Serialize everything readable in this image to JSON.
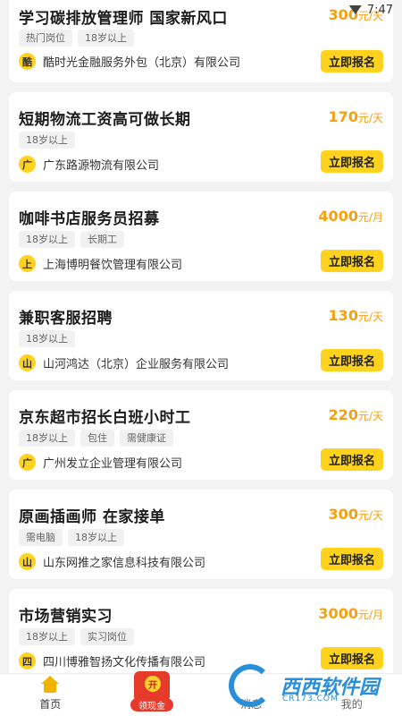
{
  "status": {
    "time": "7:47"
  },
  "jobs": [
    {
      "title": "学习碳排放管理师 国家新风口",
      "salary": "300",
      "unit": "元/天",
      "tags": [
        "热门岗位",
        "18岁以上"
      ],
      "badge": "酷",
      "company": "酷时光金融服务外包（北京）有限公司",
      "apply": "立即报名"
    },
    {
      "title": "短期物流工资高可做长期",
      "salary": "170",
      "unit": "元/天",
      "tags": [
        "18岁以上"
      ],
      "badge": "广",
      "company": "广东路源物流有限公司",
      "apply": "立即报名"
    },
    {
      "title": "咖啡书店服务员招募",
      "salary": "4000",
      "unit": "元/月",
      "tags": [
        "18岁以上",
        "长期工"
      ],
      "badge": "上",
      "company": "上海博明餐饮管理有限公司",
      "apply": "立即报名"
    },
    {
      "title": "兼职客服招聘",
      "salary": "130",
      "unit": "元/天",
      "tags": [
        "18岁以上"
      ],
      "badge": "山",
      "company": "山河鸿达（北京）企业服务有限公司",
      "apply": "立即报名"
    },
    {
      "title": "京东超市招长白班小时工",
      "salary": "220",
      "unit": "元/天",
      "tags": [
        "18岁以上",
        "包住",
        "需健康证"
      ],
      "badge": "广",
      "company": "广州发立企业管理有限公司",
      "apply": "立即报名"
    },
    {
      "title": "原画插画师 在家接单",
      "salary": "300",
      "unit": "元/天",
      "tags": [
        "需电脑",
        "18岁以上"
      ],
      "badge": "山",
      "company": "山东网推之家信息科技有限公司",
      "apply": "立即报名"
    },
    {
      "title": "市场营销实习",
      "salary": "3000",
      "unit": "元/月",
      "tags": [
        "18岁以上",
        "实习岗位"
      ],
      "badge": "四",
      "company": "四川博雅智扬文化传播有限公司",
      "apply": "立即报名"
    }
  ],
  "tabbar": {
    "home": "首页",
    "redpack_coin": "开",
    "redpack_label": "领现金",
    "messages": "消息",
    "mine": "我的"
  },
  "watermark": {
    "name": "西西软件园",
    "sub": "CR173.COM"
  }
}
